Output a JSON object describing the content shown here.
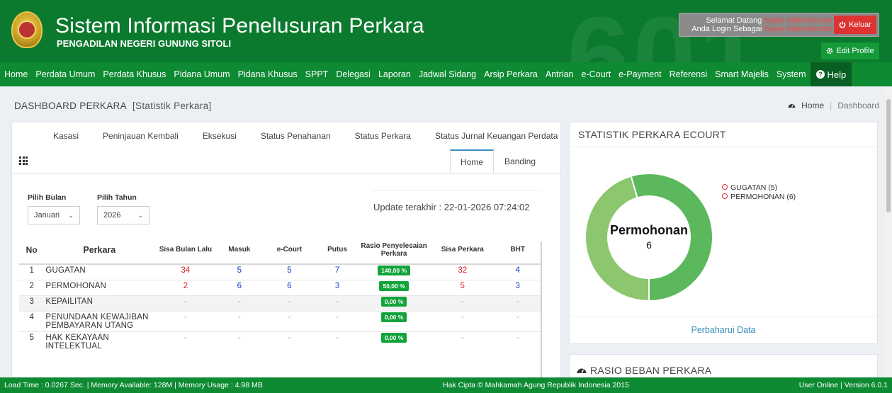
{
  "header": {
    "title": "Sistem Informasi Penelusuran Perkara",
    "subtitle": "PENGADILAN NEGERI GUNUNG SITOLI",
    "watermark": "601",
    "welcome_line1": "Selamat Datang",
    "welcome_user": "Super Administrator",
    "welcome_line2": "Anda Login Sebagai",
    "welcome_role": "Super Administrator",
    "logout_label": "Keluar",
    "edit_profile_label": "Edit Profile"
  },
  "nav": {
    "items": [
      "Home",
      "Perdata Umum",
      "Perdata Khusus",
      "Pidana Umum",
      "Pidana Khusus",
      "SPPT",
      "Delegasi",
      "Laporan",
      "Jadwal Sidang",
      "Arsip Perkara",
      "Antrian",
      "e-Court",
      "e-Payment",
      "Referensi",
      "Smart Majelis",
      "System"
    ],
    "help_label": "Help"
  },
  "page": {
    "title": "DASHBOARD PERKARA",
    "subtitle": "[Statistik Perkara]",
    "breadcrumb_home": "Home",
    "breadcrumb_current": "Dashboard"
  },
  "left_card": {
    "tabs_top": [
      "Kasasi",
      "Peninjauan Kembali",
      "Eksekusi",
      "Status Penahanan",
      "Status Perkara",
      "Status Jurnal Keuangan Perdata"
    ],
    "tabs_second": [
      "Home",
      "Banding"
    ],
    "active_tab": "Home",
    "filter_month_label": "Pilih Bulan",
    "filter_month_value": "Januari",
    "filter_year_label": "Pilih Tahun",
    "filter_year_value": "2026",
    "update_text": "Update terakhir : 22-01-2026 07:24:02",
    "table": {
      "headers": [
        "No",
        "Perkara",
        "Sisa Bulan Lalu",
        "Masuk",
        "e-Court",
        "Putus",
        "Rasio Penyelesaian Perkara",
        "Sisa Perkara",
        "BHT"
      ],
      "rows": [
        {
          "no": "1",
          "perkara": "GUGATAN",
          "sisa_bulan_lalu": "34",
          "masuk": "5",
          "ecourt": "5",
          "putus": "7",
          "rasio": "140,00 %",
          "sisa_perkara": "32",
          "bht": "4"
        },
        {
          "no": "2",
          "perkara": "PERMOHONAN",
          "sisa_bulan_lalu": "2",
          "masuk": "6",
          "ecourt": "6",
          "putus": "3",
          "rasio": "50,00 %",
          "sisa_perkara": "5",
          "bht": "3"
        },
        {
          "no": "3",
          "perkara": "KEPAILITAN",
          "sisa_bulan_lalu": "-",
          "masuk": "-",
          "ecourt": "-",
          "putus": "-",
          "rasio": "0,00 %",
          "sisa_perkara": "-",
          "bht": "-"
        },
        {
          "no": "4",
          "perkara": "PENUNDAAN KEWAJIBAN PEMBAYARAN UTANG",
          "sisa_bulan_lalu": "-",
          "masuk": "-",
          "ecourt": "-",
          "putus": "-",
          "rasio": "0,00 %",
          "sisa_perkara": "-",
          "bht": "-"
        },
        {
          "no": "5",
          "perkara": "HAK KEKAYAAN INTELEKTUAL",
          "sisa_bulan_lalu": "-",
          "masuk": "-",
          "ecourt": "-",
          "putus": "-",
          "rasio": "0,00 %",
          "sisa_perkara": "-",
          "bht": "-"
        }
      ]
    }
  },
  "ecourt_card": {
    "title": "STATISTIK PERKARA ECOURT",
    "center_label": "Permohonan",
    "center_value": "6",
    "legend": [
      "GUGATAN (5)",
      "PERMOHONAN (6)"
    ],
    "update_link": "Perbaharui Data"
  },
  "chart_data": {
    "type": "pie",
    "categories": [
      "GUGATAN",
      "PERMOHONAN"
    ],
    "values": [
      5,
      6
    ],
    "colors": [
      "#8cc66f",
      "#5cb85c"
    ]
  },
  "rasio_card": {
    "title": "RASIO BEBAN PERKARA"
  },
  "footer": {
    "left": "Load Time : 0.0267 Sec. | Memory Available: 128M | Memory Usage : 4.98 MB",
    "mid": "Hak Cipta © Mahkamah Agung Republik Indonesia 2015",
    "right": "User Online | Version 6.0.1"
  },
  "colors": {
    "header_bg": "#0b7a2e",
    "nav_bg": "#0e8a33",
    "badge": "#13a33c",
    "logout": "#dd3333"
  }
}
